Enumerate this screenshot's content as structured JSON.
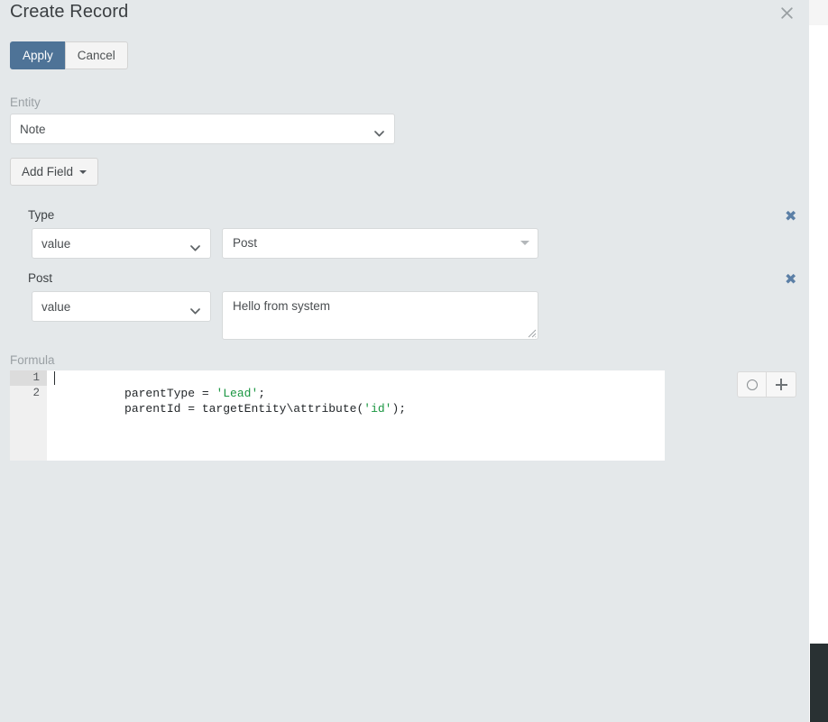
{
  "window": {
    "title": "Create Record",
    "close_icon": "close-icon"
  },
  "toolbar": {
    "apply_label": "Apply",
    "cancel_label": "Cancel",
    "apply_color": "#4e7397"
  },
  "entity": {
    "label": "Entity",
    "selected": "Note",
    "options": [
      "Note"
    ]
  },
  "add_field": {
    "label": "Add Field",
    "caret_icon": "caret-down-icon"
  },
  "fields": [
    {
      "label": "Type",
      "mode_selected": "value",
      "mode_options": [
        "value"
      ],
      "value": "Post",
      "control": "select2",
      "remove_icon": "remove-field-icon",
      "remove_glyph": "✖"
    },
    {
      "label": "Post",
      "mode_selected": "value",
      "mode_options": [
        "value"
      ],
      "value": "Hello from system",
      "control": "textarea",
      "remove_icon": "remove-field-icon",
      "remove_glyph": "✖"
    }
  ],
  "formula": {
    "label": "Formula",
    "lines": [
      {
        "number": "1",
        "segments": [
          {
            "text": "parentType = ",
            "type": "plain"
          },
          {
            "text": "'Lead'",
            "type": "string"
          },
          {
            "text": ";",
            "type": "plain"
          }
        ]
      },
      {
        "number": "2",
        "segments": [
          {
            "text": "parentId = targetEntity\\attribute(",
            "type": "plain"
          },
          {
            "text": "'id'",
            "type": "string"
          },
          {
            "text": ");",
            "type": "plain"
          }
        ]
      }
    ],
    "string_color": "#1a9641",
    "text_color": "#23272a",
    "active_line": "1"
  },
  "side_buttons": [
    {
      "icon": "circle-icon",
      "name": "formula-check-syntax-button"
    },
    {
      "icon": "plus-icon",
      "name": "formula-add-button"
    }
  ],
  "scrollbar": {
    "thumb_color": "#293133"
  }
}
